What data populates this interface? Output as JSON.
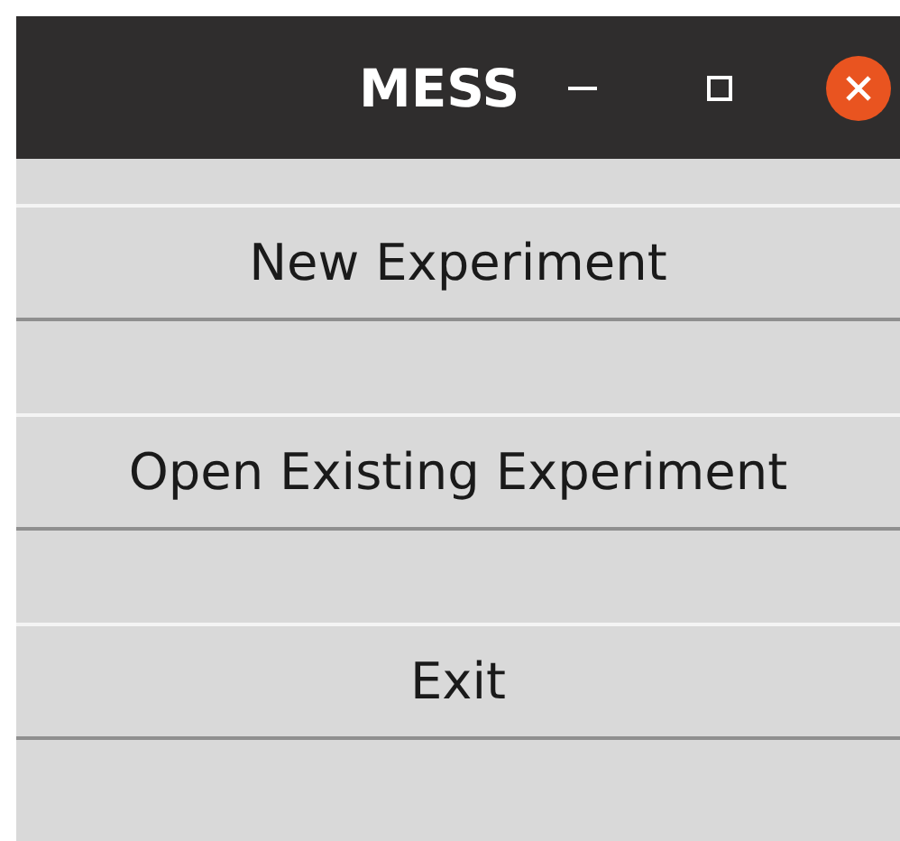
{
  "window": {
    "title": "MESS"
  },
  "buttons": [
    {
      "label": "New Experiment"
    },
    {
      "label": "Open Existing Experiment"
    },
    {
      "label": "Exit"
    }
  ]
}
